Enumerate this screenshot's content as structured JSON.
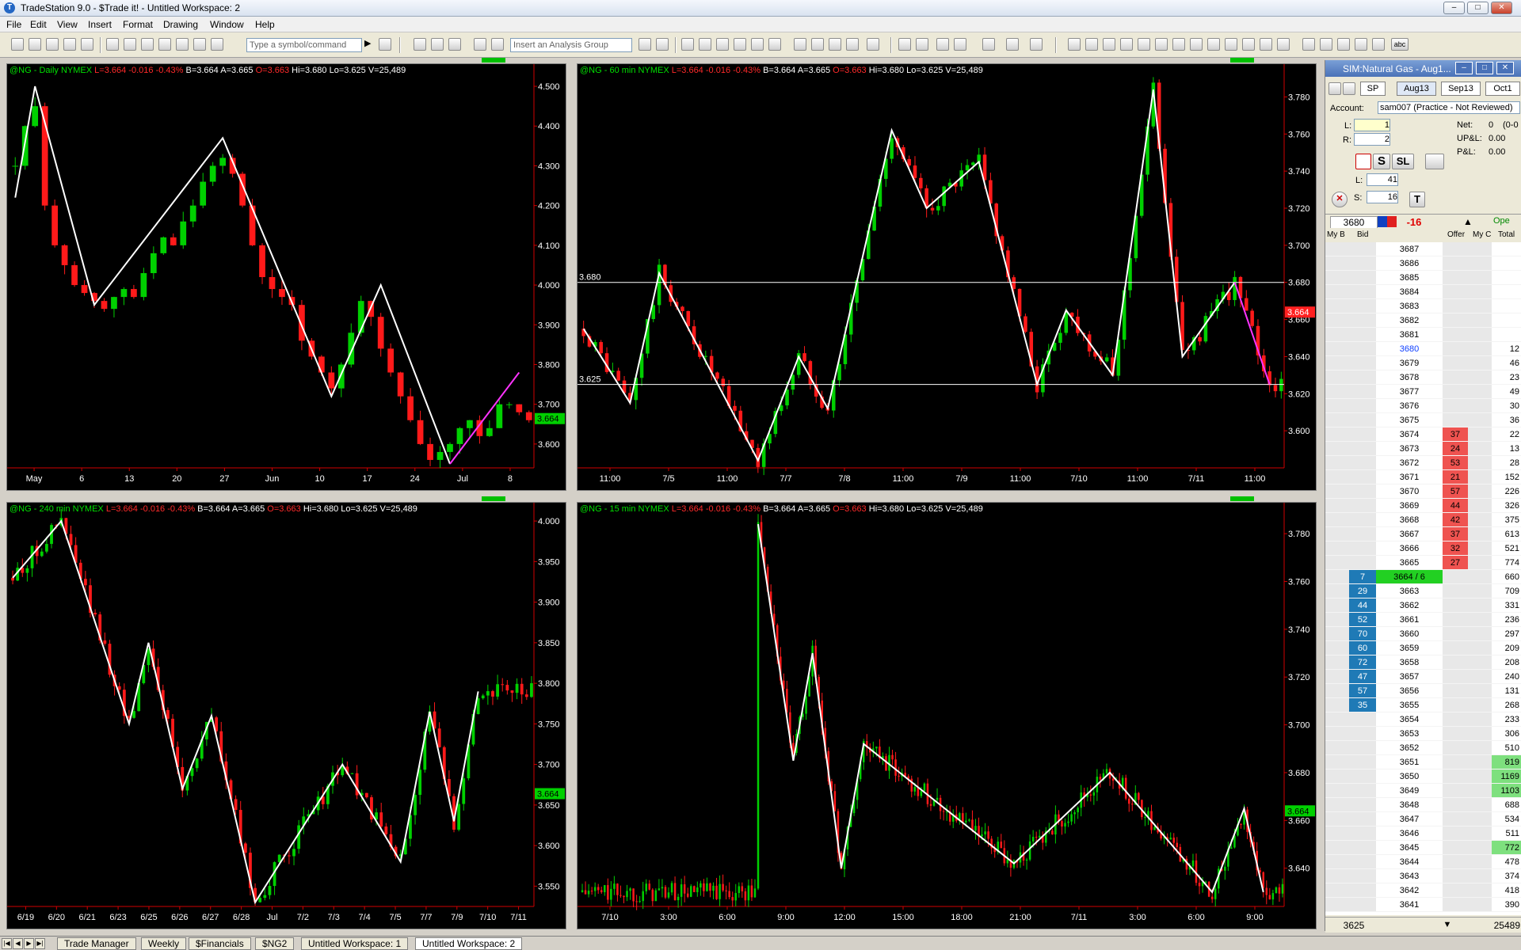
{
  "app": {
    "title": "TradeStation 9.0 - $Trade it! - Untitled Workspace: 2",
    "menu": [
      "File",
      "Edit",
      "View",
      "Insert",
      "Format",
      "Drawing",
      "Window",
      "Help"
    ],
    "symbol_placeholder": "Type a symbol/command",
    "analysis_placeholder": "Insert an Analysis Group"
  },
  "quote": {
    "symbol": "@NG",
    "exchange": "NYMEX",
    "last": "L=3.664",
    "chg": "-0.016",
    "pct": "-0.43%",
    "bid": "B=3.664",
    "ask": "A=3.665",
    "open": "O=3.663",
    "high": "Hi=3.680",
    "low": "Lo=3.625",
    "vol": "V=25,489"
  },
  "charts": [
    {
      "id": "daily",
      "interval": "Daily",
      "x_labels": [
        "May",
        "6",
        "13",
        "20",
        "27",
        "Jun",
        "10",
        "17",
        "24",
        "Jul",
        "8"
      ],
      "y_labels": [
        "4.500",
        "4.400",
        "4.300",
        "4.200",
        "4.100",
        "4.000",
        "3.900",
        "3.800",
        "3.700",
        "3.600"
      ],
      "y_range": [
        3.54,
        4.52
      ],
      "last_price": "3.664",
      "zigzag_white": [
        [
          0,
          4.22
        ],
        [
          2,
          4.5
        ],
        [
          8,
          3.95
        ],
        [
          21,
          4.37
        ],
        [
          32,
          3.72
        ],
        [
          37,
          4.0
        ],
        [
          44,
          3.55
        ]
      ],
      "zigzag_magenta": [
        [
          44,
          3.55
        ],
        [
          51,
          3.78
        ]
      ],
      "n_bars": 53,
      "closes": [
        4.3,
        4.4,
        4.45,
        4.2,
        4.1,
        4.05,
        4.0,
        3.98,
        3.96,
        3.94,
        3.97,
        3.99,
        3.97,
        4.03,
        4.08,
        4.12,
        4.1,
        4.16,
        4.2,
        4.26,
        4.3,
        4.32,
        4.28,
        4.2,
        4.1,
        4.02,
        3.99,
        3.97,
        3.95,
        3.86,
        3.82,
        3.78,
        3.74,
        3.8,
        3.88,
        3.96,
        3.92,
        3.84,
        3.78,
        3.72,
        3.66,
        3.6,
        3.56,
        3.58,
        3.6,
        3.64,
        3.66,
        3.62,
        3.64,
        3.7,
        3.7,
        3.68,
        3.66
      ]
    },
    {
      "id": "min60",
      "interval": "60 min",
      "x_labels": [
        "11:00",
        "7/5",
        "11:00",
        "7/7",
        "7/8",
        "11:00",
        "7/9",
        "11:00",
        "7/10",
        "11:00",
        "7/11",
        "11:00"
      ],
      "y_labels": [
        "3.780",
        "3.760",
        "3.740",
        "3.720",
        "3.700",
        "3.680",
        "3.660",
        "3.640",
        "3.620",
        "3.600"
      ],
      "y_range": [
        3.58,
        3.79
      ],
      "last_price": "3.664",
      "hlines": [
        {
          "price": 3.68,
          "label": "3.680"
        },
        {
          "price": 3.625,
          "label": "3.625"
        }
      ],
      "zigzag_white": [
        [
          0,
          3.655
        ],
        [
          8,
          3.615
        ],
        [
          13,
          3.685
        ],
        [
          30,
          3.584
        ],
        [
          37,
          3.64
        ],
        [
          42,
          3.612
        ],
        [
          53,
          3.762
        ],
        [
          59,
          3.72
        ],
        [
          68,
          3.745
        ],
        [
          78,
          3.625
        ],
        [
          83,
          3.665
        ],
        [
          91,
          3.63
        ],
        [
          98,
          3.784
        ],
        [
          103,
          3.64
        ],
        [
          112,
          3.68
        ]
      ],
      "zigzag_magenta": [
        [
          112,
          3.68
        ],
        [
          118,
          3.625
        ]
      ],
      "n_bars": 121
    },
    {
      "id": "min240",
      "interval": "240 min",
      "x_labels": [
        "6/19",
        "6/20",
        "6/21",
        "6/23",
        "6/25",
        "6/26",
        "6/27",
        "6/28",
        "Jul",
        "7/2",
        "7/3",
        "7/4",
        "7/5",
        "7/7",
        "7/9",
        "7/10",
        "7/11"
      ],
      "y_labels": [
        "4.000",
        "3.950",
        "3.900",
        "3.850",
        "3.800",
        "3.750",
        "3.700",
        "3.650",
        "3.600",
        "3.550"
      ],
      "y_range": [
        3.525,
        4.005
      ],
      "last_price": "3.664",
      "zigzag_white": [
        [
          0,
          3.93
        ],
        [
          10,
          4.0
        ],
        [
          24,
          3.75
        ],
        [
          28,
          3.85
        ],
        [
          35,
          3.67
        ],
        [
          41,
          3.76
        ],
        [
          50,
          3.53
        ],
        [
          68,
          3.7
        ],
        [
          80,
          3.58
        ],
        [
          86,
          3.765
        ],
        [
          91,
          3.63
        ],
        [
          96,
          3.79
        ]
      ],
      "zigzag_magenta": [],
      "n_bars": 108
    },
    {
      "id": "min15",
      "interval": "15 min",
      "x_labels": [
        "7/10",
        "3:00",
        "6:00",
        "9:00",
        "12:00",
        "15:00",
        "18:00",
        "21:00",
        "7/11",
        "3:00",
        "6:00",
        "9:00"
      ],
      "y_labels": [
        "3.780",
        "3.760",
        "3.740",
        "3.720",
        "3.700",
        "3.680",
        "3.660",
        "3.640"
      ],
      "y_range": [
        3.624,
        3.787
      ],
      "last_price": "3.664",
      "zigzag_white": [
        [
          55,
          3.784
        ],
        [
          66,
          3.685
        ],
        [
          72,
          3.73
        ],
        [
          81,
          3.64
        ],
        [
          88,
          3.692
        ],
        [
          135,
          3.642
        ],
        [
          165,
          3.68
        ],
        [
          197,
          3.63
        ],
        [
          207,
          3.665
        ],
        [
          213,
          3.63
        ]
      ],
      "zigzag_magenta": [],
      "n_bars": 220
    }
  ],
  "dom": {
    "title": "SIM:Natural Gas - Aug1...",
    "tabs": [
      "Aug13",
      "Sep13",
      "Oct1"
    ],
    "sp_label": "SP",
    "account_label": "Account:",
    "account": "sam007 (Practice - Not Reviewed)",
    "l_label": "L:",
    "l_val": "1",
    "r_label": "R:",
    "r_val": "2",
    "net_label": "Net:",
    "net_val": "0",
    "net_extra": "(0-0",
    "upl_label": "UP&L:",
    "upl_val": "0.00",
    "pl_label": "P&L:",
    "pl_val": "0.00",
    "sl_label": "SL",
    "s_btn": "S",
    "t_btn": "T",
    "ls_l_label": "L:",
    "ls_l_val": "41",
    "ls_s_label": "S:",
    "ls_s_val": "16",
    "hdr_price": "3680",
    "hdr_chg": "-16",
    "col_mybid": "My B",
    "col_bid": "Bid",
    "col_offer": "Offer",
    "col_myoffer": "My C",
    "col_total": "Total",
    "open_label": "Ope",
    "footer_price": "3625",
    "footer_total": "25489",
    "rows": [
      {
        "p": "3687",
        "b": "",
        "o": "",
        "t": ""
      },
      {
        "p": "3686",
        "b": "",
        "o": "",
        "t": ""
      },
      {
        "p": "3685",
        "b": "",
        "o": "",
        "t": ""
      },
      {
        "p": "3684",
        "b": "",
        "o": "",
        "t": ""
      },
      {
        "p": "3683",
        "b": "",
        "o": "",
        "t": ""
      },
      {
        "p": "3682",
        "b": "",
        "o": "",
        "t": ""
      },
      {
        "p": "3681",
        "b": "",
        "o": "",
        "t": ""
      },
      {
        "p": "3680",
        "b": "",
        "o": "",
        "t": "12",
        "hi": true
      },
      {
        "p": "3679",
        "b": "",
        "o": "",
        "t": "46"
      },
      {
        "p": "3678",
        "b": "",
        "o": "",
        "t": "23"
      },
      {
        "p": "3677",
        "b": "",
        "o": "",
        "t": "49"
      },
      {
        "p": "3676",
        "b": "",
        "o": "",
        "t": "30"
      },
      {
        "p": "3675",
        "b": "",
        "o": "",
        "t": "36"
      },
      {
        "p": "3674",
        "b": "",
        "o": "37",
        "t": "22"
      },
      {
        "p": "3673",
        "b": "",
        "o": "24",
        "t": "13"
      },
      {
        "p": "3672",
        "b": "",
        "o": "53",
        "t": "28"
      },
      {
        "p": "3671",
        "b": "",
        "o": "21",
        "t": "152"
      },
      {
        "p": "3670",
        "b": "",
        "o": "57",
        "t": "226"
      },
      {
        "p": "3669",
        "b": "",
        "o": "44",
        "t": "326"
      },
      {
        "p": "3668",
        "b": "",
        "o": "42",
        "t": "375"
      },
      {
        "p": "3667",
        "b": "",
        "o": "37",
        "t": "613"
      },
      {
        "p": "3666",
        "b": "",
        "o": "32",
        "t": "521"
      },
      {
        "p": "3665",
        "b": "",
        "o": "27",
        "t": "774"
      },
      {
        "p": "3664 / 6",
        "b": "7",
        "o": "",
        "t": "660",
        "last": true
      },
      {
        "p": "3663",
        "b": "29",
        "o": "",
        "t": "709"
      },
      {
        "p": "3662",
        "b": "44",
        "o": "",
        "t": "331"
      },
      {
        "p": "3661",
        "b": "52",
        "o": "",
        "t": "236"
      },
      {
        "p": "3660",
        "b": "70",
        "o": "",
        "t": "297"
      },
      {
        "p": "3659",
        "b": "60",
        "o": "",
        "t": "209"
      },
      {
        "p": "3658",
        "b": "72",
        "o": "",
        "t": "208"
      },
      {
        "p": "3657",
        "b": "47",
        "o": "",
        "t": "240"
      },
      {
        "p": "3656",
        "b": "57",
        "o": "",
        "t": "131"
      },
      {
        "p": "3655",
        "b": "35",
        "o": "",
        "t": "268"
      },
      {
        "p": "3654",
        "b": "",
        "o": "",
        "t": "233"
      },
      {
        "p": "3653",
        "b": "",
        "o": "",
        "t": "306"
      },
      {
        "p": "3652",
        "b": "",
        "o": "",
        "t": "510"
      },
      {
        "p": "3651",
        "b": "",
        "o": "",
        "t": "819",
        "tg": true
      },
      {
        "p": "3650",
        "b": "",
        "o": "",
        "t": "1169",
        "tg": true
      },
      {
        "p": "3649",
        "b": "",
        "o": "",
        "t": "1103",
        "tg": true
      },
      {
        "p": "3648",
        "b": "",
        "o": "",
        "t": "688"
      },
      {
        "p": "3647",
        "b": "",
        "o": "",
        "t": "534"
      },
      {
        "p": "3646",
        "b": "",
        "o": "",
        "t": "511"
      },
      {
        "p": "3645",
        "b": "",
        "o": "",
        "t": "772",
        "tg": true
      },
      {
        "p": "3644",
        "b": "",
        "o": "",
        "t": "478"
      },
      {
        "p": "3643",
        "b": "",
        "o": "",
        "t": "374"
      },
      {
        "p": "3642",
        "b": "",
        "o": "",
        "t": "418"
      },
      {
        "p": "3641",
        "b": "",
        "o": "",
        "t": "390"
      }
    ]
  },
  "tabs": [
    "Trade Manager",
    "Weekly",
    "$Financials",
    "$NG2",
    "Untitled Workspace: 1",
    "Untitled Workspace: 2"
  ],
  "colors": {
    "up": "#00d000",
    "down": "#ff1a1a",
    "zigzag": "#ffffff",
    "magenta": "#ff33ff",
    "bid": "#1f7ab6",
    "offer": "#ef5350"
  }
}
